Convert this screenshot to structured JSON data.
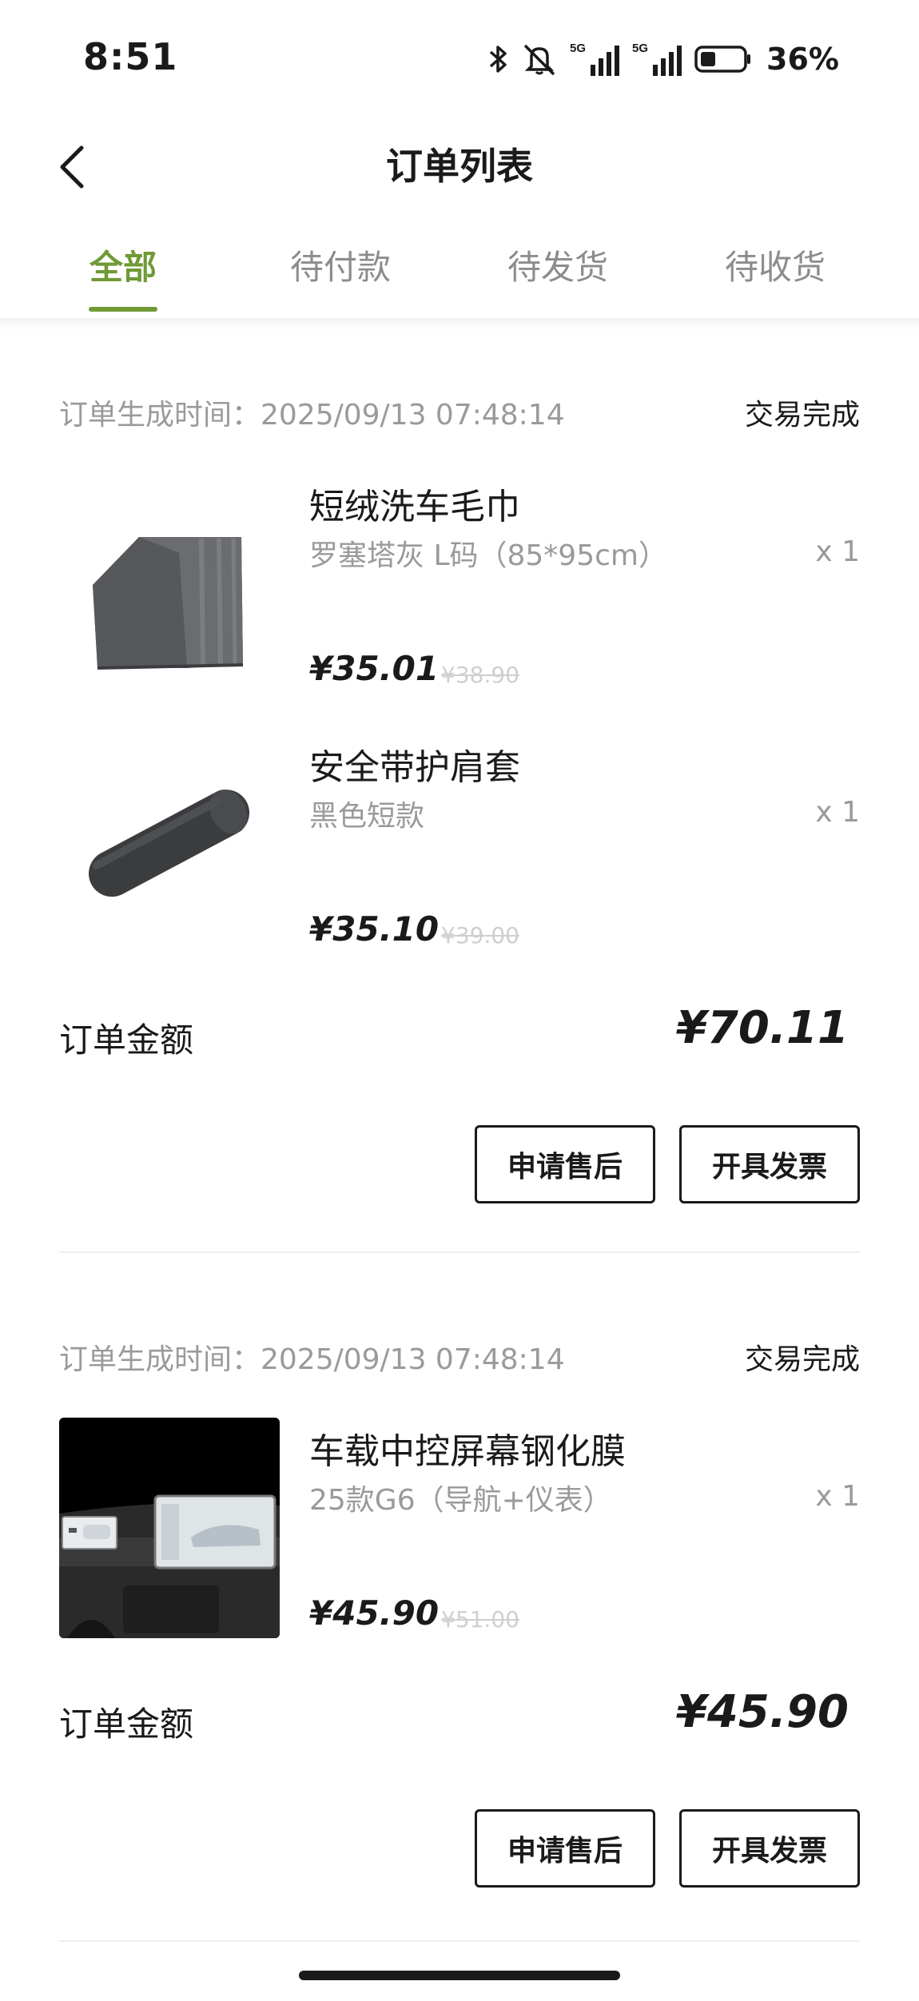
{
  "status_bar": {
    "time": "8:51",
    "battery_percent": "36%",
    "icons": [
      "bluetooth-icon",
      "mute-icon",
      "5g-signal-icon",
      "5g-signal-icon",
      "battery-icon"
    ]
  },
  "nav": {
    "title": "订单列表",
    "back_icon": "chevron-left-icon"
  },
  "tabs": [
    {
      "label": "全部",
      "active": true
    },
    {
      "label": "待付款",
      "active": false
    },
    {
      "label": "待发货",
      "active": false
    },
    {
      "label": "待收货",
      "active": false
    }
  ],
  "colors": {
    "accent": "#6f9a36",
    "muted_text": "#9a9a9a",
    "strike_price": "#cfcfcf"
  },
  "orders": [
    {
      "time_label": "订单生成时间：2025/09/13 07:48:14",
      "status": "交易完成",
      "items": [
        {
          "name": "短绒洗车毛巾",
          "spec": "罗塞塔灰 L码（85*95cm）",
          "qty": "x 1",
          "price": "¥35.01",
          "original_price": "¥38.90"
        },
        {
          "name": "安全带护肩套",
          "spec": "黑色短款",
          "qty": "x 1",
          "price": "¥35.10",
          "original_price": "¥39.00"
        }
      ],
      "total_label": "订单金额",
      "total": "¥70.11",
      "after_sale_label": "申请售后",
      "invoice_label": "开具发票"
    },
    {
      "time_label": "订单生成时间：2025/09/13 07:48:14",
      "status": "交易完成",
      "items": [
        {
          "name": "车载中控屏幕钢化膜",
          "spec": "25款G6（导航+仪表）",
          "qty": "x 1",
          "price": "¥45.90",
          "original_price": "¥51.00"
        }
      ],
      "total_label": "订单金额",
      "total": "¥45.90",
      "after_sale_label": "申请售后",
      "invoice_label": "开具发票"
    }
  ]
}
